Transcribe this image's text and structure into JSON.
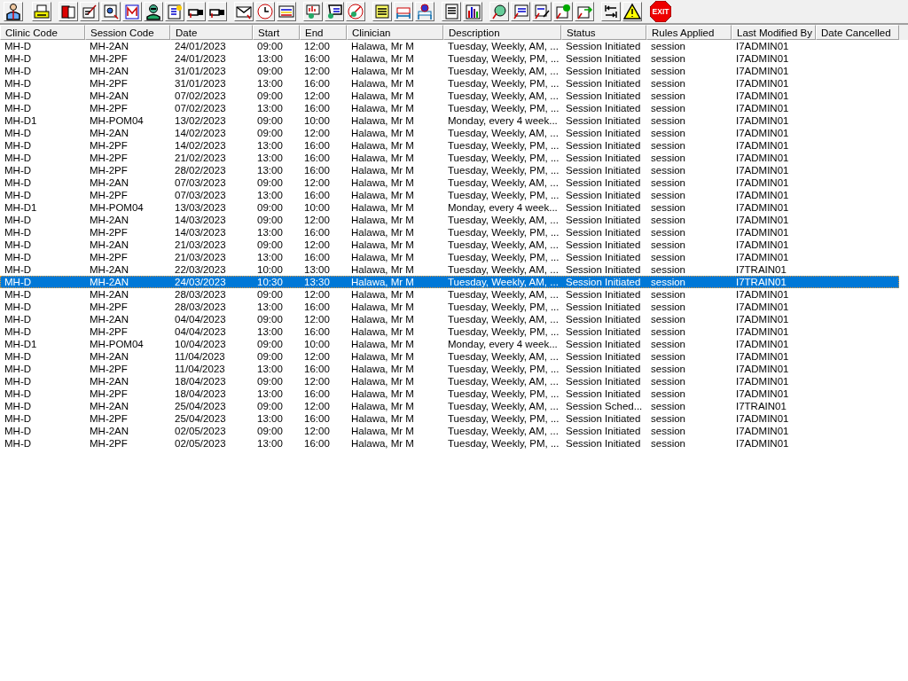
{
  "toolbar": {
    "exit_label": "EXIT"
  },
  "table": {
    "columns": [
      "Clinic Code",
      "Session Code",
      "Date",
      "Start",
      "End",
      "Clinician",
      "Description",
      "Status",
      "Rules Applied",
      "Last Modified By",
      "Date Cancelled"
    ],
    "rows": [
      {
        "cells": [
          "MH-D",
          "MH-2AN",
          "24/01/2023",
          "09:00",
          "12:00",
          "Halawa, Mr M",
          "Tuesday, Weekly, AM, ...",
          "Session Initiated",
          "session",
          "I7ADMIN01"
        ],
        "selected": false
      },
      {
        "cells": [
          "MH-D",
          "MH-2PF",
          "24/01/2023",
          "13:00",
          "16:00",
          "Halawa, Mr M",
          "Tuesday, Weekly, PM, ...",
          "Session Initiated",
          "session",
          "I7ADMIN01"
        ],
        "selected": false
      },
      {
        "cells": [
          "MH-D",
          "MH-2AN",
          "31/01/2023",
          "09:00",
          "12:00",
          "Halawa, Mr M",
          "Tuesday, Weekly, AM, ...",
          "Session Initiated",
          "session",
          "I7ADMIN01"
        ],
        "selected": false
      },
      {
        "cells": [
          "MH-D",
          "MH-2PF",
          "31/01/2023",
          "13:00",
          "16:00",
          "Halawa, Mr M",
          "Tuesday, Weekly, PM, ...",
          "Session Initiated",
          "session",
          "I7ADMIN01"
        ],
        "selected": false
      },
      {
        "cells": [
          "MH-D",
          "MH-2AN",
          "07/02/2023",
          "09:00",
          "12:00",
          "Halawa, Mr M",
          "Tuesday, Weekly, AM, ...",
          "Session Initiated",
          "session",
          "I7ADMIN01"
        ],
        "selected": false
      },
      {
        "cells": [
          "MH-D",
          "MH-2PF",
          "07/02/2023",
          "13:00",
          "16:00",
          "Halawa, Mr M",
          "Tuesday, Weekly, PM, ...",
          "Session Initiated",
          "session",
          "I7ADMIN01"
        ],
        "selected": false
      },
      {
        "cells": [
          "MH-D1",
          "MH-POM04",
          "13/02/2023",
          "09:00",
          "10:00",
          "Halawa, Mr M",
          "Monday, every 4 week...",
          "Session Initiated",
          "session",
          "I7ADMIN01"
        ],
        "selected": false
      },
      {
        "cells": [
          "MH-D",
          "MH-2AN",
          "14/02/2023",
          "09:00",
          "12:00",
          "Halawa, Mr M",
          "Tuesday, Weekly, AM, ...",
          "Session Initiated",
          "session",
          "I7ADMIN01"
        ],
        "selected": false
      },
      {
        "cells": [
          "MH-D",
          "MH-2PF",
          "14/02/2023",
          "13:00",
          "16:00",
          "Halawa, Mr M",
          "Tuesday, Weekly, PM, ...",
          "Session Initiated",
          "session",
          "I7ADMIN01"
        ],
        "selected": false
      },
      {
        "cells": [
          "MH-D",
          "MH-2PF",
          "21/02/2023",
          "13:00",
          "16:00",
          "Halawa, Mr M",
          "Tuesday, Weekly, PM, ...",
          "Session Initiated",
          "session",
          "I7ADMIN01"
        ],
        "selected": false
      },
      {
        "cells": [
          "MH-D",
          "MH-2PF",
          "28/02/2023",
          "13:00",
          "16:00",
          "Halawa, Mr M",
          "Tuesday, Weekly, PM, ...",
          "Session Initiated",
          "session",
          "I7ADMIN01"
        ],
        "selected": false
      },
      {
        "cells": [
          "MH-D",
          "MH-2AN",
          "07/03/2023",
          "09:00",
          "12:00",
          "Halawa, Mr M",
          "Tuesday, Weekly, AM, ...",
          "Session Initiated",
          "session",
          "I7ADMIN01"
        ],
        "selected": false
      },
      {
        "cells": [
          "MH-D",
          "MH-2PF",
          "07/03/2023",
          "13:00",
          "16:00",
          "Halawa, Mr M",
          "Tuesday, Weekly, PM, ...",
          "Session Initiated",
          "session",
          "I7ADMIN01"
        ],
        "selected": false
      },
      {
        "cells": [
          "MH-D1",
          "MH-POM04",
          "13/03/2023",
          "09:00",
          "10:00",
          "Halawa, Mr M",
          "Monday, every 4 week...",
          "Session Initiated",
          "session",
          "I7ADMIN01"
        ],
        "selected": false
      },
      {
        "cells": [
          "MH-D",
          "MH-2AN",
          "14/03/2023",
          "09:00",
          "12:00",
          "Halawa, Mr M",
          "Tuesday, Weekly, AM, ...",
          "Session Initiated",
          "session",
          "I7ADMIN01"
        ],
        "selected": false
      },
      {
        "cells": [
          "MH-D",
          "MH-2PF",
          "14/03/2023",
          "13:00",
          "16:00",
          "Halawa, Mr M",
          "Tuesday, Weekly, PM, ...",
          "Session Initiated",
          "session",
          "I7ADMIN01"
        ],
        "selected": false
      },
      {
        "cells": [
          "MH-D",
          "MH-2AN",
          "21/03/2023",
          "09:00",
          "12:00",
          "Halawa, Mr M",
          "Tuesday, Weekly, AM, ...",
          "Session Initiated",
          "session",
          "I7ADMIN01"
        ],
        "selected": false
      },
      {
        "cells": [
          "MH-D",
          "MH-2PF",
          "21/03/2023",
          "13:00",
          "16:00",
          "Halawa, Mr M",
          "Tuesday, Weekly, PM, ...",
          "Session Initiated",
          "session",
          "I7ADMIN01"
        ],
        "selected": false
      },
      {
        "cells": [
          "MH-D",
          "MH-2AN",
          "22/03/2023",
          "10:00",
          "13:00",
          "Halawa, Mr M",
          "Tuesday, Weekly, AM, ...",
          "Session Initiated",
          "session",
          "I7TRAIN01"
        ],
        "selected": false
      },
      {
        "cells": [
          "MH-D",
          "MH-2AN",
          "24/03/2023",
          "10:30",
          "13:30",
          "Halawa, Mr M",
          "Tuesday, Weekly, AM, ...",
          "Session Initiated",
          "session",
          "I7TRAIN01"
        ],
        "selected": true
      },
      {
        "cells": [
          "MH-D",
          "MH-2AN",
          "28/03/2023",
          "09:00",
          "12:00",
          "Halawa, Mr M",
          "Tuesday, Weekly, AM, ...",
          "Session Initiated",
          "session",
          "I7ADMIN01"
        ],
        "selected": false
      },
      {
        "cells": [
          "MH-D",
          "MH-2PF",
          "28/03/2023",
          "13:00",
          "16:00",
          "Halawa, Mr M",
          "Tuesday, Weekly, PM, ...",
          "Session Initiated",
          "session",
          "I7ADMIN01"
        ],
        "selected": false
      },
      {
        "cells": [
          "MH-D",
          "MH-2AN",
          "04/04/2023",
          "09:00",
          "12:00",
          "Halawa, Mr M",
          "Tuesday, Weekly, AM, ...",
          "Session Initiated",
          "session",
          "I7ADMIN01"
        ],
        "selected": false
      },
      {
        "cells": [
          "MH-D",
          "MH-2PF",
          "04/04/2023",
          "13:00",
          "16:00",
          "Halawa, Mr M",
          "Tuesday, Weekly, PM, ...",
          "Session Initiated",
          "session",
          "I7ADMIN01"
        ],
        "selected": false
      },
      {
        "cells": [
          "MH-D1",
          "MH-POM04",
          "10/04/2023",
          "09:00",
          "10:00",
          "Halawa, Mr M",
          "Monday, every 4 week...",
          "Session Initiated",
          "session",
          "I7ADMIN01"
        ],
        "selected": false
      },
      {
        "cells": [
          "MH-D",
          "MH-2AN",
          "11/04/2023",
          "09:00",
          "12:00",
          "Halawa, Mr M",
          "Tuesday, Weekly, AM, ...",
          "Session Initiated",
          "session",
          "I7ADMIN01"
        ],
        "selected": false
      },
      {
        "cells": [
          "MH-D",
          "MH-2PF",
          "11/04/2023",
          "13:00",
          "16:00",
          "Halawa, Mr M",
          "Tuesday, Weekly, PM, ...",
          "Session Initiated",
          "session",
          "I7ADMIN01"
        ],
        "selected": false
      },
      {
        "cells": [
          "MH-D",
          "MH-2AN",
          "18/04/2023",
          "09:00",
          "12:00",
          "Halawa, Mr M",
          "Tuesday, Weekly, AM, ...",
          "Session Initiated",
          "session",
          "I7ADMIN01"
        ],
        "selected": false
      },
      {
        "cells": [
          "MH-D",
          "MH-2PF",
          "18/04/2023",
          "13:00",
          "16:00",
          "Halawa, Mr M",
          "Tuesday, Weekly, PM, ...",
          "Session Initiated",
          "session",
          "I7ADMIN01"
        ],
        "selected": false
      },
      {
        "cells": [
          "MH-D",
          "MH-2AN",
          "25/04/2023",
          "09:00",
          "12:00",
          "Halawa, Mr M",
          "Tuesday, Weekly, AM, ...",
          "Session Sched...",
          "session",
          "I7TRAIN01"
        ],
        "selected": false
      },
      {
        "cells": [
          "MH-D",
          "MH-2PF",
          "25/04/2023",
          "13:00",
          "16:00",
          "Halawa, Mr M",
          "Tuesday, Weekly, PM, ...",
          "Session Initiated",
          "session",
          "I7ADMIN01"
        ],
        "selected": false
      },
      {
        "cells": [
          "MH-D",
          "MH-2AN",
          "02/05/2023",
          "09:00",
          "12:00",
          "Halawa, Mr M",
          "Tuesday, Weekly, AM, ...",
          "Session Initiated",
          "session",
          "I7ADMIN01"
        ],
        "selected": false
      },
      {
        "cells": [
          "MH-D",
          "MH-2PF",
          "02/05/2023",
          "13:00",
          "16:00",
          "Halawa, Mr M",
          "Tuesday, Weekly, PM, ...",
          "Session Initiated",
          "session",
          "I7ADMIN01"
        ],
        "selected": false
      }
    ]
  }
}
